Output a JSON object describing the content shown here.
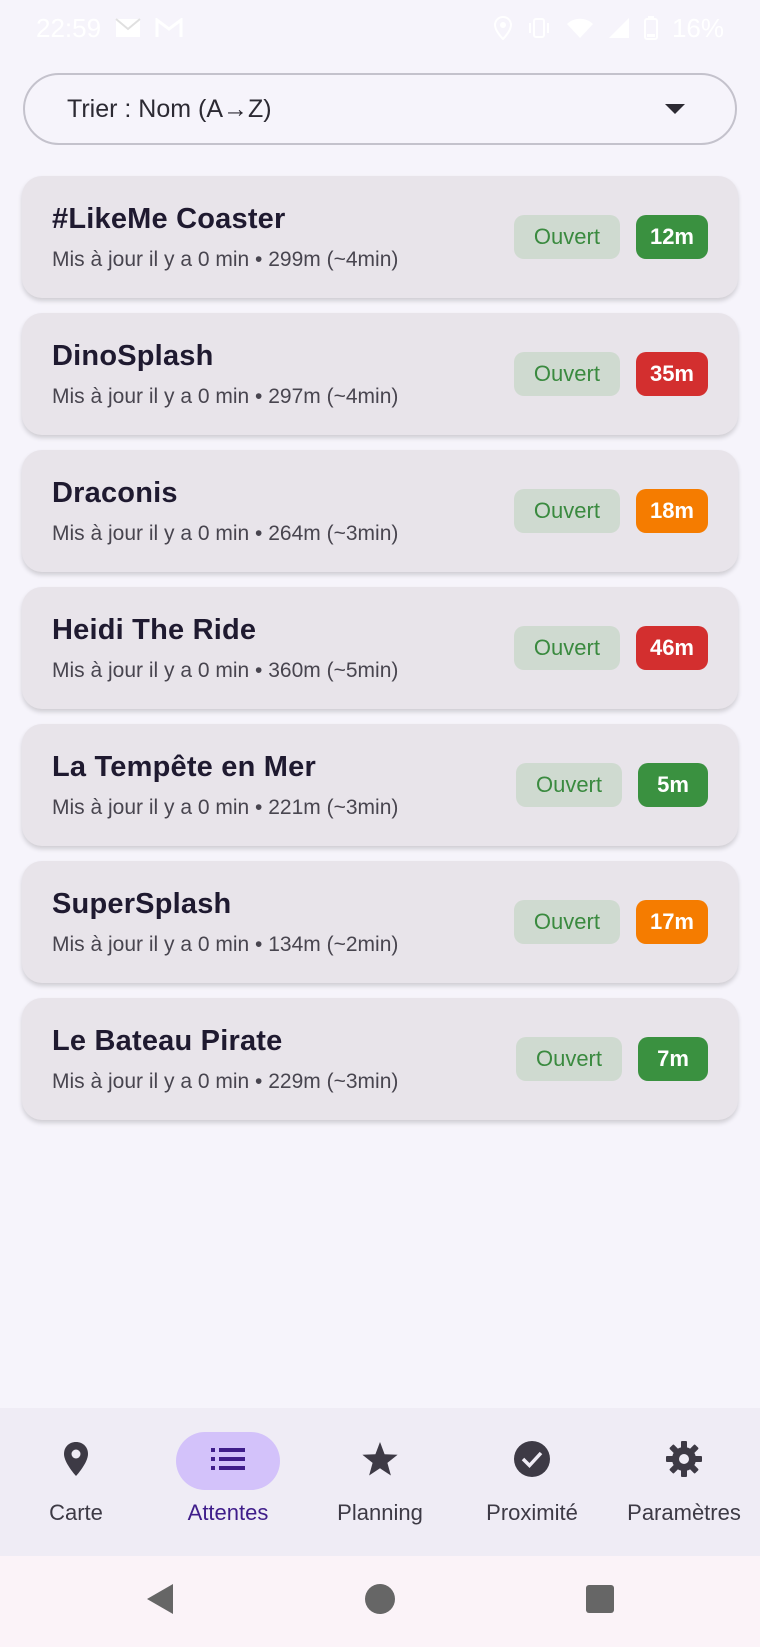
{
  "status_bar": {
    "time": "22:59",
    "battery": "16%",
    "icons": [
      "mail-icon",
      "gmail-icon",
      "location-icon",
      "vibrate-icon",
      "wifi-icon",
      "signal-icon",
      "battery-icon"
    ]
  },
  "sort": {
    "label": "Trier : Nom (A→Z)",
    "icon": "dropdown-caret-icon"
  },
  "rides": [
    {
      "name": "#LikeMe Coaster",
      "subtitle": "Mis à jour il y a 0 min • 299m (~4min)",
      "status": "Ouvert",
      "wait": "12m",
      "wait_color": "#3a9140"
    },
    {
      "name": "DinoSplash",
      "subtitle": "Mis à jour il y a 0 min • 297m (~4min)",
      "status": "Ouvert",
      "wait": "35m",
      "wait_color": "#d32f2f"
    },
    {
      "name": "Draconis",
      "subtitle": "Mis à jour il y a 0 min • 264m (~3min)",
      "status": "Ouvert",
      "wait": "18m",
      "wait_color": "#f57c00"
    },
    {
      "name": "Heidi The Ride",
      "subtitle": "Mis à jour il y a 0 min • 360m (~5min)",
      "status": "Ouvert",
      "wait": "46m",
      "wait_color": "#d32f2f"
    },
    {
      "name": "La Tempête en Mer",
      "subtitle": "Mis à jour il y a 0 min • 221m (~3min)",
      "status": "Ouvert",
      "wait": "5m",
      "wait_color": "#3a9140"
    },
    {
      "name": "SuperSplash",
      "subtitle": "Mis à jour il y a 0 min • 134m (~2min)",
      "status": "Ouvert",
      "wait": "17m",
      "wait_color": "#f57c00"
    },
    {
      "name": "Le Bateau Pirate",
      "subtitle": "Mis à jour il y a 0 min • 229m (~3min)",
      "status": "Ouvert",
      "wait": "7m",
      "wait_color": "#3a9140"
    }
  ],
  "nav": {
    "active": "Attentes",
    "items": [
      {
        "label": "Carte",
        "icon": "map-pin-icon"
      },
      {
        "label": "Attentes",
        "icon": "list-icon"
      },
      {
        "label": "Planning",
        "icon": "star-icon"
      },
      {
        "label": "Proximité",
        "icon": "check-circle-icon"
      },
      {
        "label": "Paramètres",
        "icon": "gear-icon"
      }
    ]
  },
  "system_nav": {
    "icons": [
      "back-icon",
      "home-icon",
      "recents-icon"
    ]
  },
  "colors": {
    "background": "#f6f4fb",
    "card": "#e8e4ea",
    "status_bg": "#cfdad0",
    "status_text": "#3a8a3f",
    "active_pill": "#d3c2fa"
  }
}
